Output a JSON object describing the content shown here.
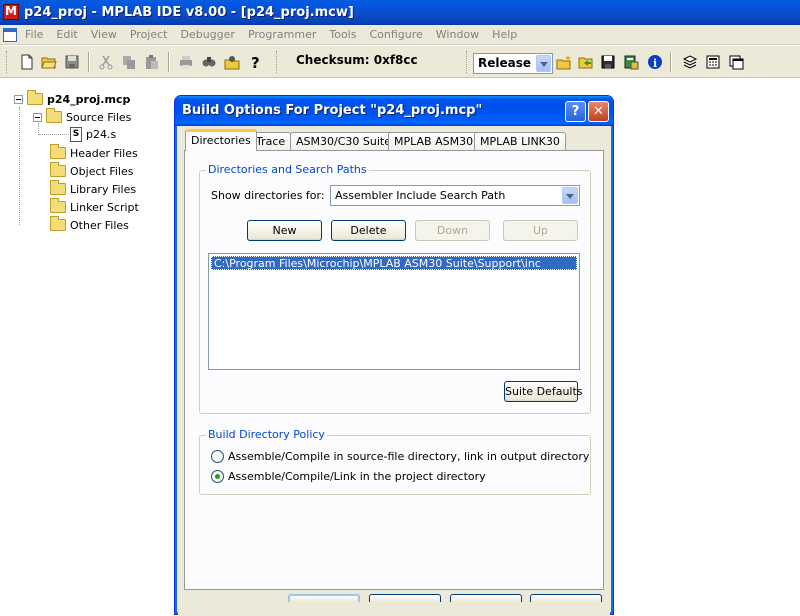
{
  "window": {
    "title": "p24_proj - MPLAB IDE v8.00 - [p24_proj.mcw]"
  },
  "menu": [
    "File",
    "Edit",
    "View",
    "Project",
    "Debugger",
    "Programmer",
    "Tools",
    "Configure",
    "Window",
    "Help"
  ],
  "toolbar": {
    "checksum": "Checksum: 0xf8cc",
    "build_config": "Release",
    "icons": [
      "new-file-icon",
      "open-icon",
      "save-icon",
      "cut-icon",
      "copy-icon",
      "paste-icon",
      "print-icon",
      "find-icon",
      "find-in-files-icon",
      "help-icon",
      "new-project-icon",
      "open-project-icon",
      "save-project-icon",
      "build-icon",
      "info-icon",
      "stack-icon",
      "calculator-icon",
      "window-icon"
    ]
  },
  "project_tree": {
    "root": "p24_proj.mcp",
    "source_files": "Source Files",
    "source_file_items": [
      "p24.s"
    ],
    "header_files": "Header Files",
    "object_files": "Object Files",
    "library_files": "Library Files",
    "linker_script": "Linker Script",
    "other_files": "Other Files"
  },
  "dialog": {
    "title": "Build Options For Project \"p24_proj.mcp\"",
    "tabs": [
      "Directories",
      "Trace",
      "ASM30/C30 Suite",
      "MPLAB ASM30",
      "MPLAB LINK30"
    ],
    "active_tab": "Directories",
    "search_paths_group": "Directories and Search Paths",
    "show_dirs_label": "Show directories for:",
    "show_dirs_value": "Assembler Include Search Path",
    "buttons": {
      "new": "New",
      "delete": "Delete",
      "down": "Down",
      "up": "Up",
      "suite_defaults": "Suite Defaults"
    },
    "paths": [
      "C:\\Program Files\\Microchip\\MPLAB ASM30 Suite\\Support\\inc"
    ],
    "policy_group": "Build Directory Policy",
    "policy_options": [
      {
        "label": "Assemble/Compile in source-file directory, link in output directory",
        "checked": false
      },
      {
        "label": "Assemble/Compile/Link in the project directory",
        "checked": true
      }
    ]
  }
}
